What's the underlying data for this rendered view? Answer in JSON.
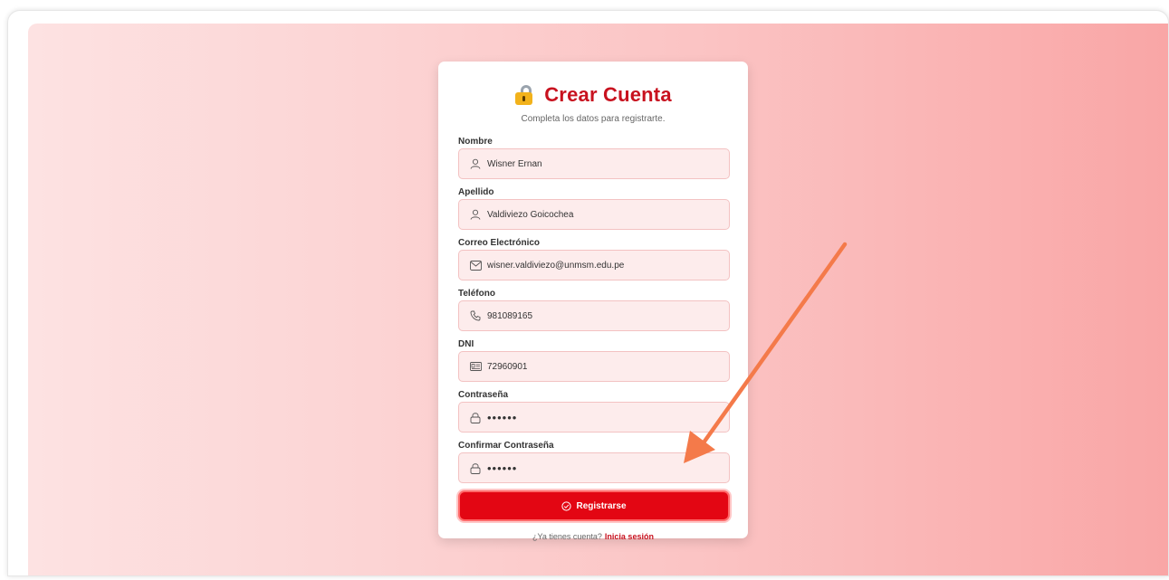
{
  "form": {
    "title": "Crear Cuenta",
    "subtitle": "Completa los datos para registrarte.",
    "fields": [
      {
        "label": "Nombre",
        "value": "Wisner Ernan",
        "icon": "user-icon"
      },
      {
        "label": "Apellido",
        "value": "Valdiviezo Goicochea",
        "icon": "user-icon"
      },
      {
        "label": "Correo Electrónico",
        "value": "wisner.valdiviezo@unmsm.edu.pe",
        "icon": "mail-icon"
      },
      {
        "label": "Teléfono",
        "value": "981089165",
        "icon": "phone-icon"
      },
      {
        "label": "DNI",
        "value": "72960901",
        "icon": "id-card-icon"
      },
      {
        "label": "Contraseña",
        "value": "••••••",
        "icon": "lock-icon"
      },
      {
        "label": "Confirmar Contraseña",
        "value": "••••••",
        "icon": "lock-icon"
      }
    ],
    "submit_label": "Registrarse",
    "footer_text": "¿Ya tienes cuenta?",
    "login_link": "Inicia sesión"
  },
  "colors": {
    "accent": "#e30613",
    "title": "#c8121f",
    "input_bg": "#fdecec",
    "arrow": "#f47a4a"
  }
}
